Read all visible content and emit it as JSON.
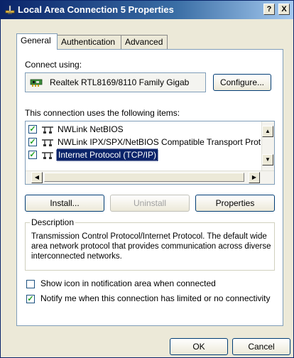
{
  "window": {
    "title": "Local Area Connection 5 Properties",
    "help_button": "?",
    "close_button": "X"
  },
  "tabs": [
    {
      "label": "General",
      "active": true
    },
    {
      "label": "Authentication",
      "active": false
    },
    {
      "label": "Advanced",
      "active": false
    }
  ],
  "connect_using": {
    "label": "Connect using:",
    "adapter_name": "Realtek RTL8169/8110 Family Gigab",
    "configure_button": "Configure..."
  },
  "items_section": {
    "label": "This connection uses the following items:",
    "items": [
      {
        "label": "NWLink NetBIOS",
        "checked": true,
        "selected": false
      },
      {
        "label": "NWLink IPX/SPX/NetBIOS Compatible Transport Prot",
        "checked": true,
        "selected": false
      },
      {
        "label": "Internet Protocol (TCP/IP)",
        "checked": true,
        "selected": true
      }
    ],
    "install_button": "Install...",
    "uninstall_button": "Uninstall",
    "properties_button": "Properties"
  },
  "description": {
    "label": "Description",
    "text": "Transmission Control Protocol/Internet Protocol. The default wide area network protocol that provides communication across diverse interconnected networks."
  },
  "options": {
    "show_icon": {
      "label": "Show icon in notification area when connected",
      "checked": false
    },
    "notify_me": {
      "label": "Notify me when this connection has limited or no connectivity",
      "checked": true
    }
  },
  "footer": {
    "ok_button": "OK",
    "cancel_button": "Cancel"
  },
  "colors": {
    "title_bar": "#0a246a",
    "selection": "#0a246a",
    "dialog_bg": "#ece9d8",
    "check_mark": "#21a121"
  },
  "icons": {
    "title": "network-connection-icon",
    "adapter": "network-card-icon",
    "protocol": "network-protocol-icon"
  }
}
